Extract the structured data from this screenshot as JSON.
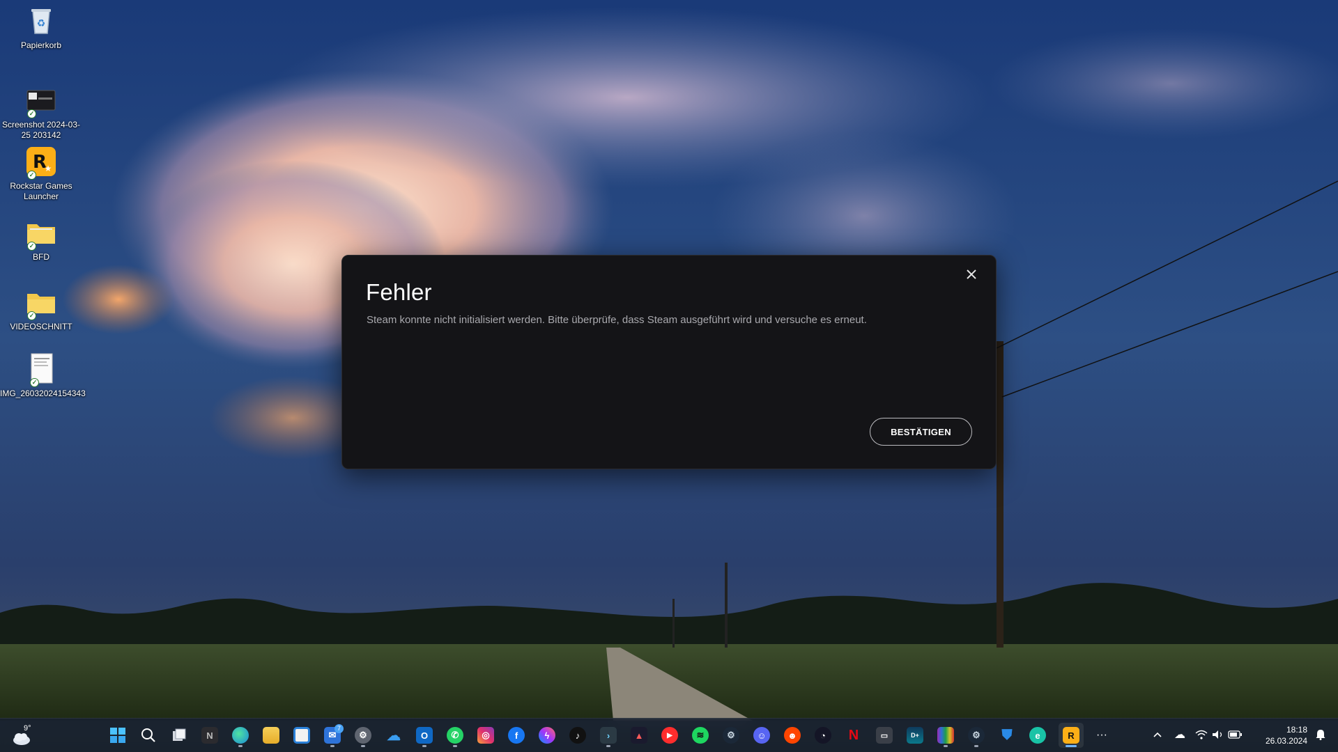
{
  "desktop": {
    "icons": [
      {
        "name": "Papierkorb"
      },
      {
        "name": "Screenshot 2024-03-25 203142"
      },
      {
        "name": "Rockstar Games Launcher"
      },
      {
        "name": "BFD"
      },
      {
        "name": "VIDEOSCHNITT"
      },
      {
        "name": "IMG_26032024154343"
      }
    ]
  },
  "dialog": {
    "title": "Fehler",
    "message": "Steam konnte nicht initialisiert werden. Bitte überprüfe, dass Steam ausgeführt wird und versuche es erneut.",
    "confirm_label": "BESTÄTIGEN"
  },
  "taskbar": {
    "weather_temp": "9°",
    "mail_badge": "7",
    "apps": [
      "start",
      "search",
      "task-view",
      "notion",
      "edge",
      "file-explorer",
      "microsoft-store",
      "mail",
      "settings",
      "onedrive",
      "outlook",
      "whatsapp",
      "instagram",
      "facebook",
      "messenger",
      "tiktok",
      "terminal",
      "affinity",
      "youtube-music",
      "spotify",
      "steam",
      "discord",
      "reddit",
      "speedtest",
      "netflix",
      "game-bar",
      "disney-plus",
      "winrar",
      "steam-alt",
      "defender",
      "edge-beta",
      "rockstar"
    ],
    "more_label": "···"
  },
  "tray": {
    "time": "18:18",
    "date": "26.03.2024"
  },
  "colors": {
    "dialog_bg": "#141417",
    "accent_indicator": "#6fb6ff"
  }
}
